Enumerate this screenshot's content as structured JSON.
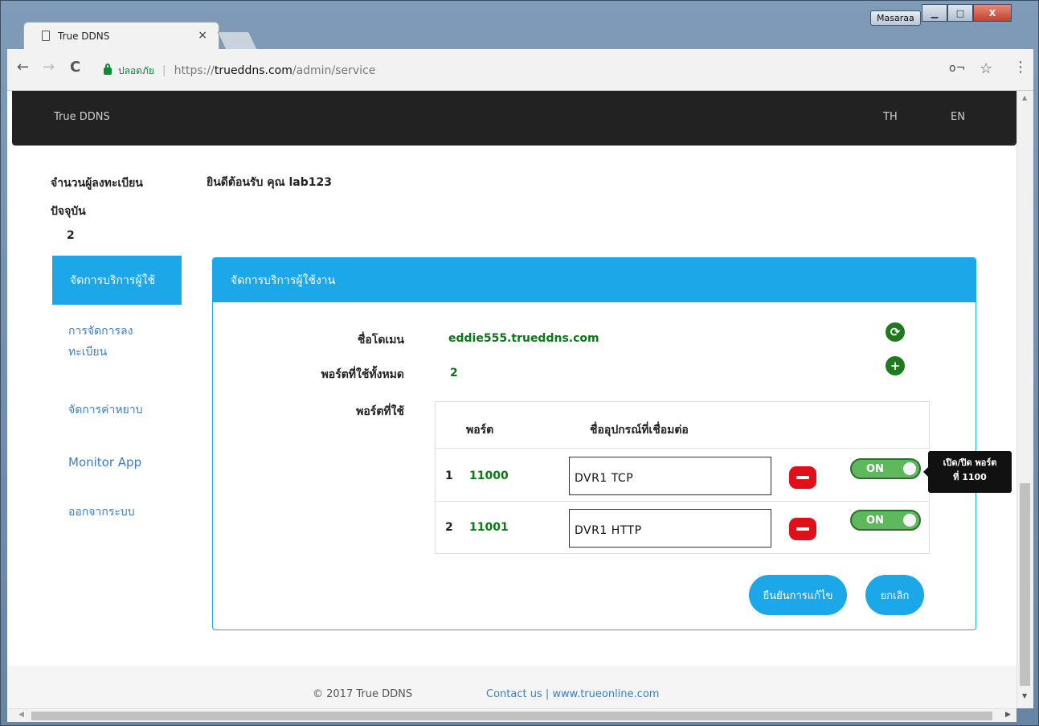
{
  "browser": {
    "tab_title": "True DDNS",
    "tab_close": "×",
    "window_user": "Masaraa",
    "min_btn": "▁",
    "max_btn": "□",
    "close_btn": "X",
    "back": "←",
    "forward": "→",
    "reload": "C",
    "secure_label": "ปลอดภัย",
    "url_scheme": "https://",
    "url_host": "trueddns.com",
    "url_path": "/admin/service",
    "key_icon": "o¬",
    "star_icon": "☆",
    "menu_icon": "⋮"
  },
  "navbar": {
    "brand": "True DDNS",
    "lang_th": "TH",
    "lang_en": "EN"
  },
  "sidebar": {
    "registered_label": "จำนวนผู้ลงทะเบียน ปัจจุบัน",
    "registered_count": "2",
    "items": [
      {
        "label": "จัดการบริการผู้ใช้"
      },
      {
        "label": "การจัดการลง ทะเบียน"
      },
      {
        "label": "จัดการค่าหยาบ"
      },
      {
        "label": "Monitor App"
      },
      {
        "label": "ออกจากระบบ"
      }
    ]
  },
  "welcome": "ยินดีต้อนรับ คุณ lab123",
  "panel": {
    "title": "จัดการบริการผู้ใช้งาน",
    "domain_label": "ชื่อโดเมน",
    "domain_value": "eddie555.trueddns.com",
    "ports_total_label": "พอร์ตที่ใช้ทั้งหมด",
    "ports_total_value": "2",
    "ports_used_label": "พอร์ตที่ใช้",
    "refresh_icon": "⟳",
    "add_icon": "+",
    "table": {
      "col_port": "พอร์ต",
      "col_device": "ชื่ออุปกรณ์ที่เชื่อมต่อ",
      "rows": [
        {
          "num": "1",
          "port": "11000",
          "device": "DVR1 TCP",
          "toggle": "ON"
        },
        {
          "num": "2",
          "port": "11001",
          "device": "DVR1 HTTP",
          "toggle": "ON"
        }
      ]
    },
    "confirm_label": "ยืนยันการแก้ไข",
    "cancel_label": "ยกเลิก"
  },
  "tooltip": {
    "line1": "เปิด/ปิด พอร์ต",
    "line2": "ที่ 1100"
  },
  "footer": {
    "copyright": "© 2017 True DDNS",
    "contact": "Contact us | www.trueonline.com"
  },
  "colors": {
    "accent": "#1ba7e8",
    "green": "#0a7a16",
    "danger": "#e0101a",
    "navbar": "#222222"
  }
}
